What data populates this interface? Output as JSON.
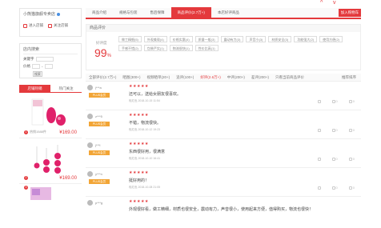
{
  "top": {
    "chevron_up": "^",
    "chevron_down": "v"
  },
  "shop": {
    "name": "小熊猫旗舰专卖店",
    "enter_label": "进入店铺",
    "follow_label": "关注店铺"
  },
  "shop_search": {
    "title": "店内搜索",
    "keyword_label": "关键字",
    "price_label": "价格",
    "button": "搜索"
  },
  "rank": {
    "tabs": [
      "店铺热销",
      "热门关注"
    ],
    "products": [
      {
        "num": "1",
        "meta": "热销1588件",
        "price": "¥169.00"
      },
      {
        "num": "2",
        "meta": "",
        "price": "¥169.00"
      },
      {
        "num": "3",
        "meta": "",
        "price": ""
      }
    ]
  },
  "main": {
    "tabs": [
      "商品介绍",
      "规格与包装",
      "售后保障",
      "商品评价(2.7万+)",
      "本店好评商品"
    ],
    "add_cart": "加入购物车",
    "rating_title": "商品评价",
    "good_rate_label": "好评度",
    "good_rate": "99",
    "good_rate_unit": "%",
    "tags": [
      "做工精细(5)",
      "外观美观(4)",
      "价格实惠(4)",
      "质量一般(3)",
      "震动有力(3)",
      "声音小(3)",
      "材质安全(3)",
      "功能强大(2)",
      "使用方便(2)",
      "手感不错(2)",
      "包装严实(1)",
      "物流很快(1)",
      "性价比高(1)"
    ],
    "filters": [
      "全部评价(2.7万+)",
      "晒图(300+)",
      "视频晒单(20+)",
      "追评(100+)",
      "好评(2.6万+)",
      "中评(200+)",
      "差评(200+)",
      "只看当前商品评价"
    ],
    "sort": "推荐排序"
  },
  "comments": [
    {
      "user": "j***a",
      "vip": "PLUS会员",
      "stars": "★★★★★",
      "text": "还可以，送给女朋友很喜欢。",
      "meta": "玫红色 2018-10-15 11:54",
      "likes": "0",
      "replies": "0"
    },
    {
      "user": "z***5",
      "vip": "PLUS会员",
      "stars": "★★★★★",
      "text": "不错，物流很快。",
      "meta": "玫红色 2018-10-12 19:23",
      "likes": "0",
      "replies": "0"
    },
    {
      "user": "j***l",
      "vip": "PLUS会员",
      "stars": "★★★★★",
      "text": "东西很好用，很满意",
      "meta": "玫红色 2018-10-10 16:41",
      "likes": "0",
      "replies": "0"
    },
    {
      "user": "y***n",
      "vip": "PLUS会员",
      "stars": "★★★★★",
      "text": "挺好用的！",
      "meta": "玫红色 2018-10-08 21:05",
      "likes": "0",
      "replies": "0"
    },
    {
      "user": "p***g",
      "vip": "PLUS会员",
      "stars": "★★★★★",
      "text": "外观很好看，做工精细，材质也很安全，震动有力，声音很小，使用起来方便，值得购买，物流也很快！",
      "meta": "",
      "likes": "",
      "replies": ""
    }
  ],
  "colors": {
    "accent": "#e4393c",
    "vip": "#f2a536",
    "product": "#e0216a"
  }
}
